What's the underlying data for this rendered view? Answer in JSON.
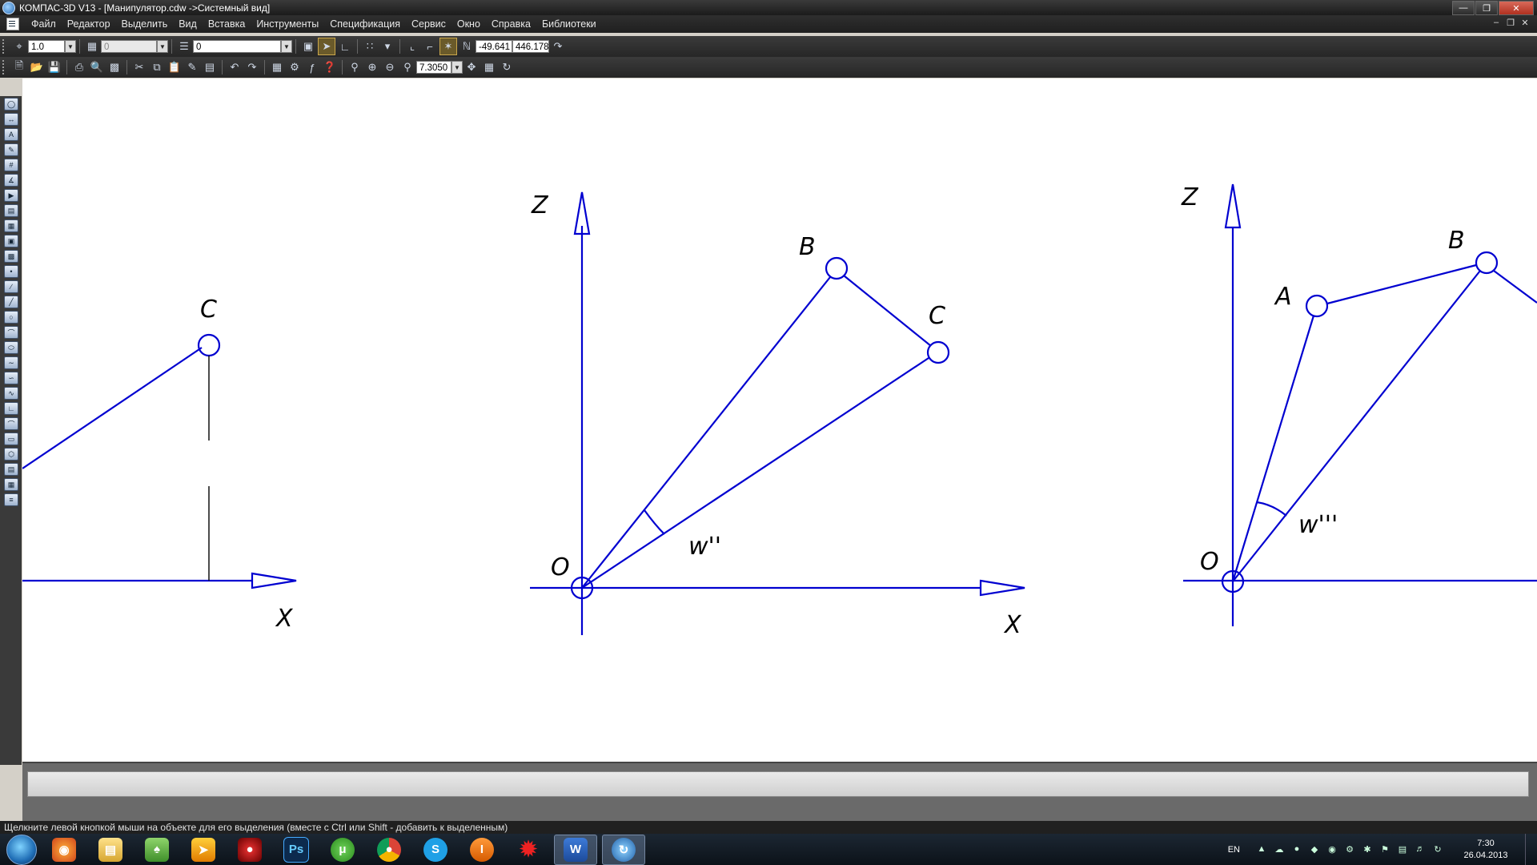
{
  "window": {
    "title": "КОМПАС-3D V13 - [Манипулятор.cdw ->Системный вид]"
  },
  "menu": [
    "Файл",
    "Редактор",
    "Выделить",
    "Вид",
    "Вставка",
    "Инструменты",
    "Спецификация",
    "Сервис",
    "Окно",
    "Справка",
    "Библиотеки"
  ],
  "toolbar1": {
    "scale": "1.0",
    "layer_style": "0",
    "layer": "0",
    "coord_x": "-49.641",
    "coord_y": "446.178"
  },
  "toolbar2": {
    "zoom": "7.3050"
  },
  "drawing": {
    "left": {
      "point_c": "C",
      "axis_x": "X"
    },
    "middle": {
      "axis_z": "Z",
      "axis_x": "X",
      "point_o": "O",
      "point_b": "B",
      "point_c": "C",
      "angle": "w''"
    },
    "right": {
      "axis_z": "Z",
      "point_o": "O",
      "point_a": "A",
      "point_b": "B",
      "angle": "w'''"
    }
  },
  "status": {
    "text": "Щелкните левой кнопкой мыши на объекте для его выделения (вместе с Ctrl или Shift - добавить к выделенным)"
  },
  "tray": {
    "lang": "EN",
    "time": "7:30",
    "date": "26.04.2013"
  },
  "taskbar": {
    "apps": [
      "firefox-icon",
      "explorer-icon",
      "games-icon",
      "aim-icon",
      "tube-icon",
      "photoshop-icon",
      "utorrent-icon",
      "chrome-icon",
      "skype-icon",
      "ilauncher-icon",
      "splash-icon",
      "word-icon",
      "kompas-icon"
    ]
  },
  "colors": {
    "drawing": "#0000d0",
    "canvas": "#ffffff"
  }
}
